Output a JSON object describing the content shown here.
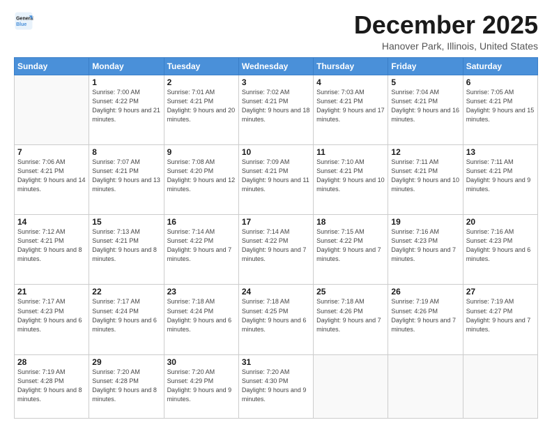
{
  "logo": {
    "line1": "General",
    "line2": "Blue"
  },
  "header": {
    "month": "December 2025",
    "location": "Hanover Park, Illinois, United States"
  },
  "weekdays": [
    "Sunday",
    "Monday",
    "Tuesday",
    "Wednesday",
    "Thursday",
    "Friday",
    "Saturday"
  ],
  "weeks": [
    [
      {
        "num": "",
        "empty": true
      },
      {
        "num": "1",
        "sunrise": "7:00 AM",
        "sunset": "4:22 PM",
        "daylight": "9 hours and 21 minutes."
      },
      {
        "num": "2",
        "sunrise": "7:01 AM",
        "sunset": "4:21 PM",
        "daylight": "9 hours and 20 minutes."
      },
      {
        "num": "3",
        "sunrise": "7:02 AM",
        "sunset": "4:21 PM",
        "daylight": "9 hours and 18 minutes."
      },
      {
        "num": "4",
        "sunrise": "7:03 AM",
        "sunset": "4:21 PM",
        "daylight": "9 hours and 17 minutes."
      },
      {
        "num": "5",
        "sunrise": "7:04 AM",
        "sunset": "4:21 PM",
        "daylight": "9 hours and 16 minutes."
      },
      {
        "num": "6",
        "sunrise": "7:05 AM",
        "sunset": "4:21 PM",
        "daylight": "9 hours and 15 minutes."
      }
    ],
    [
      {
        "num": "7",
        "sunrise": "7:06 AM",
        "sunset": "4:21 PM",
        "daylight": "9 hours and 14 minutes."
      },
      {
        "num": "8",
        "sunrise": "7:07 AM",
        "sunset": "4:21 PM",
        "daylight": "9 hours and 13 minutes."
      },
      {
        "num": "9",
        "sunrise": "7:08 AM",
        "sunset": "4:20 PM",
        "daylight": "9 hours and 12 minutes."
      },
      {
        "num": "10",
        "sunrise": "7:09 AM",
        "sunset": "4:21 PM",
        "daylight": "9 hours and 11 minutes."
      },
      {
        "num": "11",
        "sunrise": "7:10 AM",
        "sunset": "4:21 PM",
        "daylight": "9 hours and 10 minutes."
      },
      {
        "num": "12",
        "sunrise": "7:11 AM",
        "sunset": "4:21 PM",
        "daylight": "9 hours and 10 minutes."
      },
      {
        "num": "13",
        "sunrise": "7:11 AM",
        "sunset": "4:21 PM",
        "daylight": "9 hours and 9 minutes."
      }
    ],
    [
      {
        "num": "14",
        "sunrise": "7:12 AM",
        "sunset": "4:21 PM",
        "daylight": "9 hours and 8 minutes."
      },
      {
        "num": "15",
        "sunrise": "7:13 AM",
        "sunset": "4:21 PM",
        "daylight": "9 hours and 8 minutes."
      },
      {
        "num": "16",
        "sunrise": "7:14 AM",
        "sunset": "4:22 PM",
        "daylight": "9 hours and 7 minutes."
      },
      {
        "num": "17",
        "sunrise": "7:14 AM",
        "sunset": "4:22 PM",
        "daylight": "9 hours and 7 minutes."
      },
      {
        "num": "18",
        "sunrise": "7:15 AM",
        "sunset": "4:22 PM",
        "daylight": "9 hours and 7 minutes."
      },
      {
        "num": "19",
        "sunrise": "7:16 AM",
        "sunset": "4:23 PM",
        "daylight": "9 hours and 7 minutes."
      },
      {
        "num": "20",
        "sunrise": "7:16 AM",
        "sunset": "4:23 PM",
        "daylight": "9 hours and 6 minutes."
      }
    ],
    [
      {
        "num": "21",
        "sunrise": "7:17 AM",
        "sunset": "4:23 PM",
        "daylight": "9 hours and 6 minutes."
      },
      {
        "num": "22",
        "sunrise": "7:17 AM",
        "sunset": "4:24 PM",
        "daylight": "9 hours and 6 minutes."
      },
      {
        "num": "23",
        "sunrise": "7:18 AM",
        "sunset": "4:24 PM",
        "daylight": "9 hours and 6 minutes."
      },
      {
        "num": "24",
        "sunrise": "7:18 AM",
        "sunset": "4:25 PM",
        "daylight": "9 hours and 6 minutes."
      },
      {
        "num": "25",
        "sunrise": "7:18 AM",
        "sunset": "4:26 PM",
        "daylight": "9 hours and 7 minutes."
      },
      {
        "num": "26",
        "sunrise": "7:19 AM",
        "sunset": "4:26 PM",
        "daylight": "9 hours and 7 minutes."
      },
      {
        "num": "27",
        "sunrise": "7:19 AM",
        "sunset": "4:27 PM",
        "daylight": "9 hours and 7 minutes."
      }
    ],
    [
      {
        "num": "28",
        "sunrise": "7:19 AM",
        "sunset": "4:28 PM",
        "daylight": "9 hours and 8 minutes."
      },
      {
        "num": "29",
        "sunrise": "7:20 AM",
        "sunset": "4:28 PM",
        "daylight": "9 hours and 8 minutes."
      },
      {
        "num": "30",
        "sunrise": "7:20 AM",
        "sunset": "4:29 PM",
        "daylight": "9 hours and 9 minutes."
      },
      {
        "num": "31",
        "sunrise": "7:20 AM",
        "sunset": "4:30 PM",
        "daylight": "9 hours and 9 minutes."
      },
      {
        "num": "",
        "empty": true
      },
      {
        "num": "",
        "empty": true
      },
      {
        "num": "",
        "empty": true
      }
    ]
  ]
}
